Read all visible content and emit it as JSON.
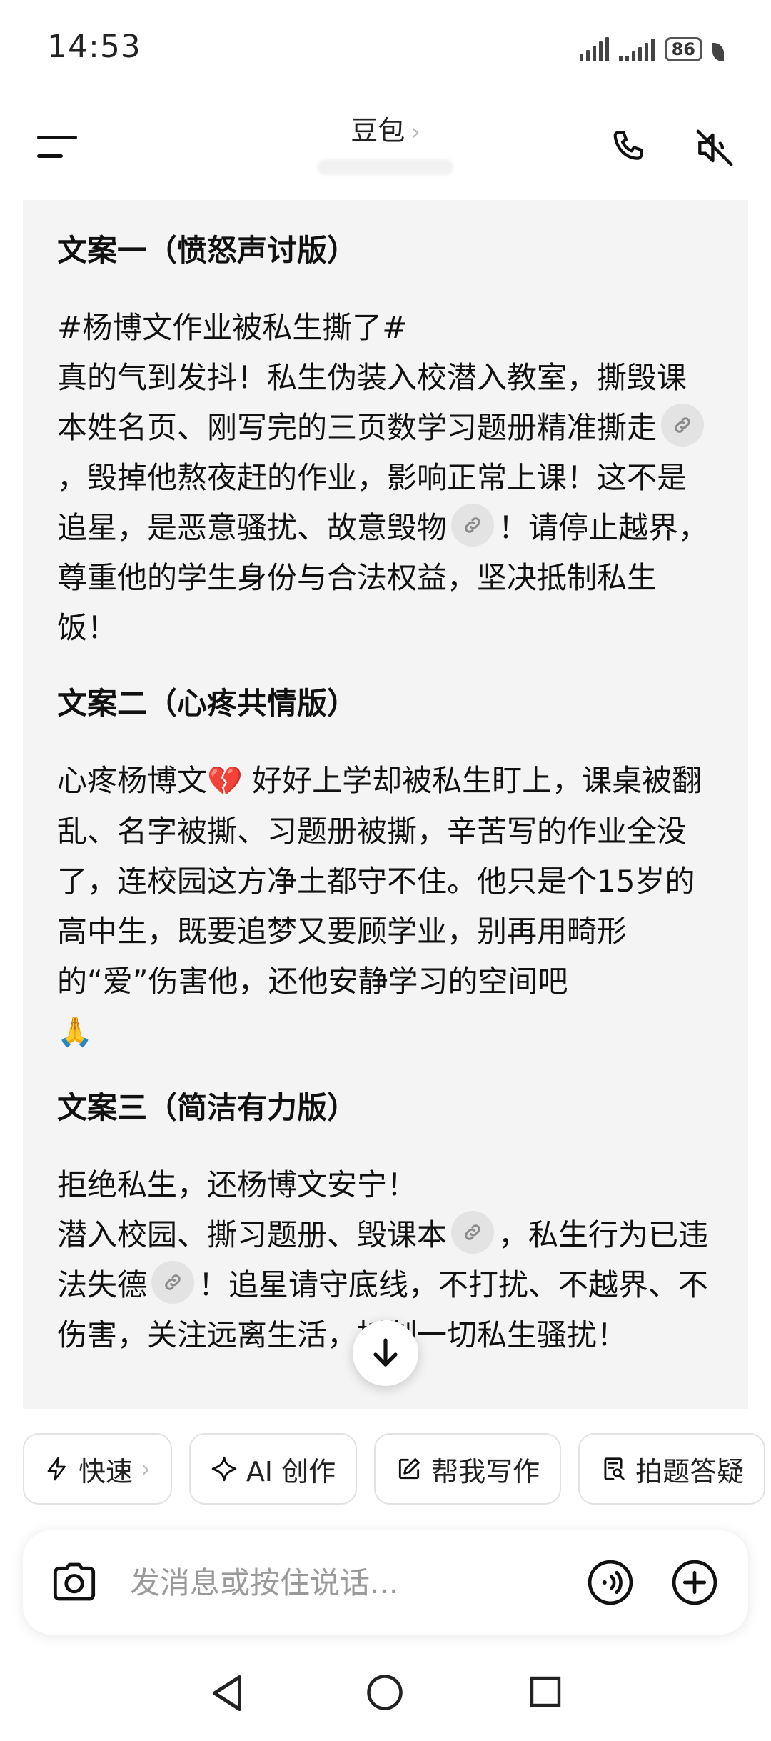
{
  "status_bar": {
    "time": "14:53",
    "battery": "86"
  },
  "header": {
    "title": "豆包",
    "title_chevron": "›"
  },
  "content": {
    "sections": [
      {
        "title": "文案一（愤怒声讨版）",
        "lines": [
          "#杨博文作业被私生撕了#",
          "真的气到发抖！私生伪装入校潜入教室，撕毁课本姓名页、刚写完的三页数学习题册精准撕走",
          "，毁掉他熬夜赶的作业，影响正常上课！这不是追星，是恶意骚扰、故意毁物",
          "！请停止越界，尊重他的学生身份与合法权益，坚决抵制私生饭！"
        ]
      },
      {
        "title": "文案二（心疼共情版）",
        "lines": [
          "心疼杨博文",
          " 好好上学却被私生盯上，课桌被翻乱、名字被撕、习题册被撕，辛苦写的作业全没了，连校园这方净土都守不住。他只是个15岁的高中生，既要追梦又要顾学业，别再用畸形的“爱”伤害他，还他安静学习的空间吧"
        ]
      },
      {
        "title": "文案三（简洁有力版）",
        "lines": [
          "拒绝私生，还杨博文安宁！",
          "潜入校园、撕习题册、毁课本",
          "，私生行为已违法失德",
          "！追星请守底线，不打扰、不越界、不伤害，关注",
          "远离生活，抵制一切私生骚扰！"
        ]
      }
    ],
    "emoji_broken_heart": "💔",
    "emoji_pray": "🙏"
  },
  "quick_actions": [
    {
      "label": "快速",
      "chevron": "›"
    },
    {
      "label": "AI 创作"
    },
    {
      "label": "帮我写作"
    },
    {
      "label": "拍题答疑"
    }
  ],
  "input_bar": {
    "placeholder": "发消息或按住说话..."
  },
  "icons": {
    "menu": "menu-icon",
    "call": "phone-icon",
    "mute": "speaker-muted-icon",
    "link": "link-icon",
    "scroll_down": "arrow-down-icon",
    "camera": "camera-icon",
    "voice": "voice-icon",
    "plus": "plus-icon",
    "nav_back": "back-triangle-icon",
    "nav_home": "home-circle-icon",
    "nav_recent": "recent-square-icon"
  }
}
